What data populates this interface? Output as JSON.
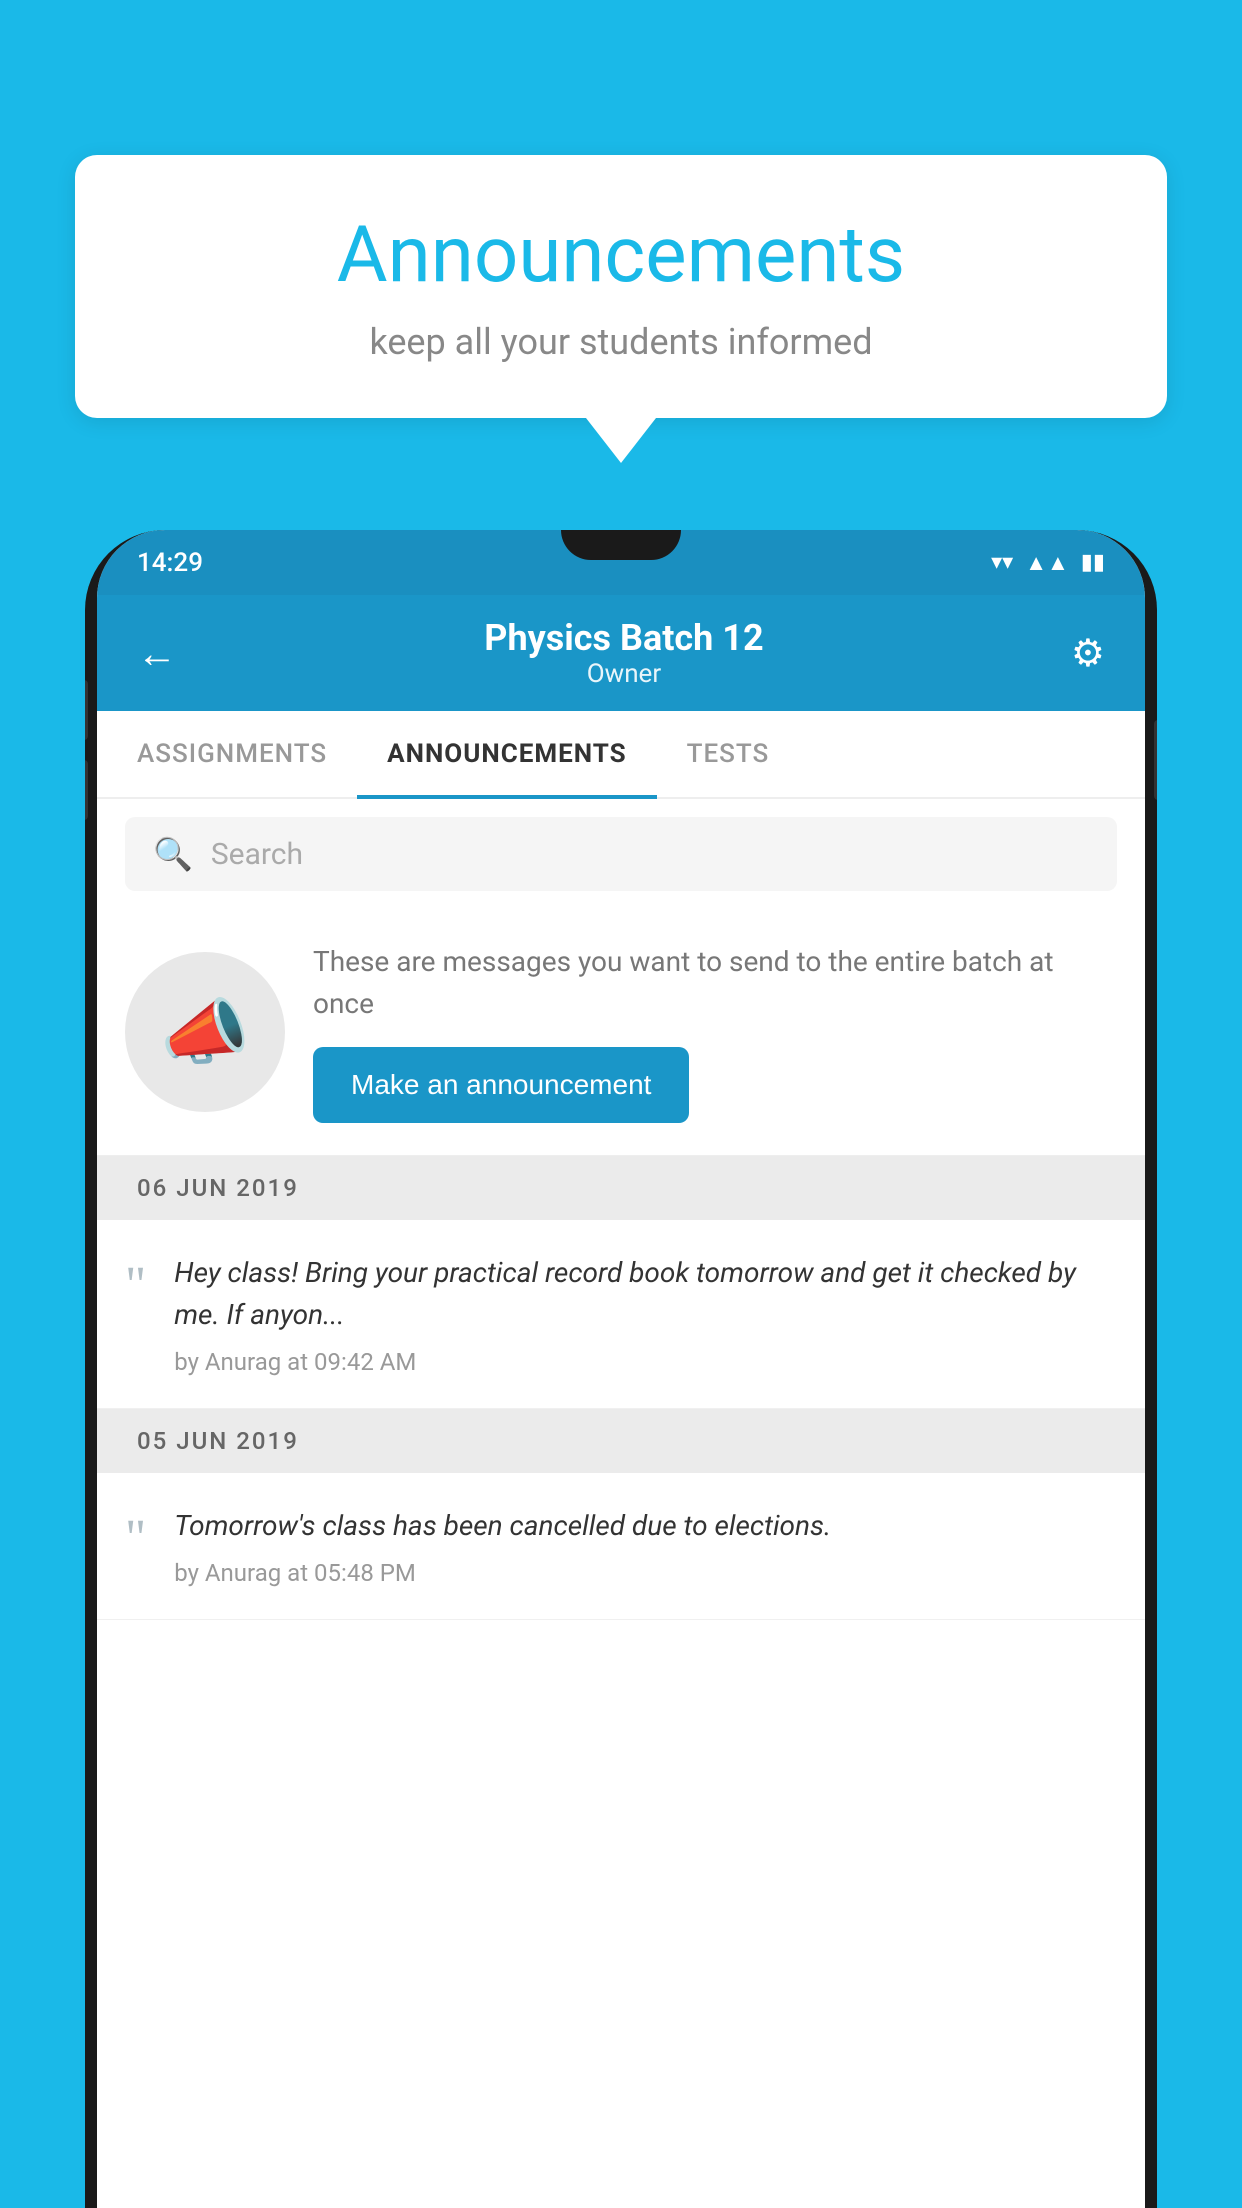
{
  "page": {
    "background_color": "#1ab9e8"
  },
  "speech_bubble": {
    "title": "Announcements",
    "subtitle": "keep all your students informed",
    "title_color": "#1ab9e8"
  },
  "status_bar": {
    "time": "14:29",
    "background": "#1a96c8"
  },
  "app_header": {
    "title": "Physics Batch 12",
    "subtitle": "Owner",
    "back_label": "←",
    "settings_label": "⚙"
  },
  "tabs": [
    {
      "label": "ASSIGNMENTS",
      "active": false
    },
    {
      "label": "ANNOUNCEMENTS",
      "active": true
    },
    {
      "label": "TESTS",
      "active": false
    }
  ],
  "search": {
    "placeholder": "Search"
  },
  "promo_card": {
    "description": "These are messages you want to send to the entire batch at once",
    "button_label": "Make an announcement"
  },
  "announcements": [
    {
      "date": "06  JUN  2019",
      "text": "Hey class! Bring your practical record book tomorrow and get it checked by me. If anyon...",
      "meta": "by Anurag at 09:42 AM"
    },
    {
      "date": "05  JUN  2019",
      "text": "Tomorrow's class has been cancelled due to elections.",
      "meta": "by Anurag at 05:48 PM"
    }
  ]
}
